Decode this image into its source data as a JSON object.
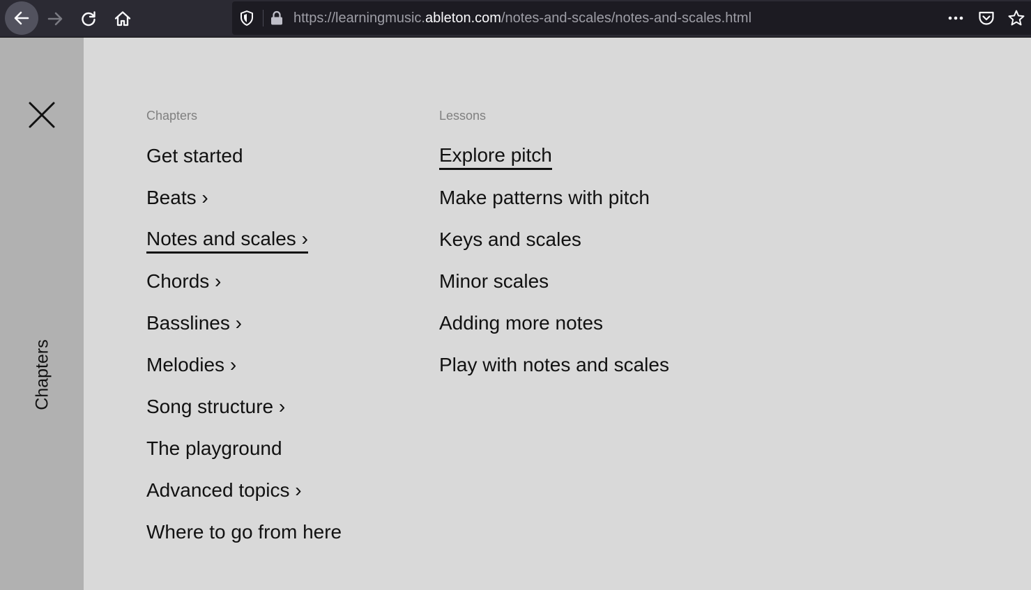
{
  "browser": {
    "url_prefix": "https://learningmusic.",
    "url_host": "ableton.com",
    "url_path": "/notes-and-scales/notes-and-scales.html"
  },
  "sidebar": {
    "label": "Chapters"
  },
  "chapters": {
    "heading": "Chapters",
    "items": [
      {
        "label": "Get started"
      },
      {
        "label": "Beats ›"
      },
      {
        "label": "Notes and scales ›"
      },
      {
        "label": "Chords ›"
      },
      {
        "label": "Basslines ›"
      },
      {
        "label": "Melodies ›"
      },
      {
        "label": "Song structure ›"
      },
      {
        "label": "The playground"
      },
      {
        "label": "Advanced topics ›"
      },
      {
        "label": "Where to go from here"
      }
    ]
  },
  "lessons": {
    "heading": "Lessons",
    "items": [
      {
        "label": "Explore pitch"
      },
      {
        "label": "Make patterns with pitch"
      },
      {
        "label": "Keys and scales"
      },
      {
        "label": "Minor scales"
      },
      {
        "label": "Adding more notes"
      },
      {
        "label": "Play with notes and scales"
      }
    ]
  },
  "colors": {
    "page_bg": "#d9d9d9",
    "sidebar_bg": "#b1b1b1",
    "text": "#111111",
    "muted": "#808080",
    "toolbar_bg": "#2b2a33"
  }
}
